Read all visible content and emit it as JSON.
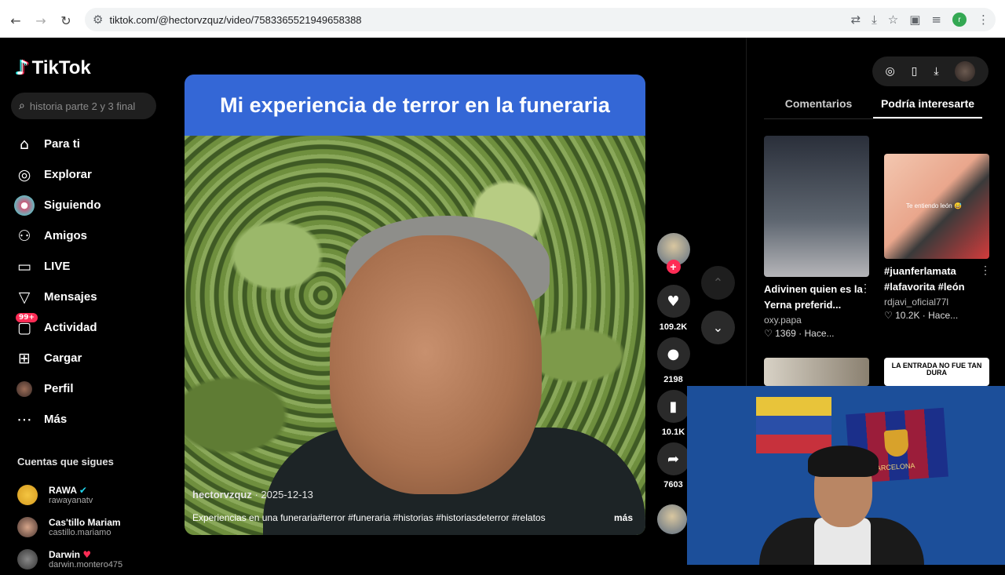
{
  "browser": {
    "url": "tiktok.com/@hectorvzquz/video/7583365521949658388",
    "profile_initial": "r"
  },
  "sidebar": {
    "logo": "TikTok",
    "search_placeholder": "historia parte 2 y 3 final",
    "nav": [
      {
        "label": "Para ti",
        "icon": "home-icon"
      },
      {
        "label": "Explorar",
        "icon": "compass-icon"
      },
      {
        "label": "Siguiendo",
        "icon": "following-icon"
      },
      {
        "label": "Amigos",
        "icon": "friends-icon"
      },
      {
        "label": "LIVE",
        "icon": "live-icon"
      },
      {
        "label": "Mensajes",
        "icon": "messages-icon"
      },
      {
        "label": "Actividad",
        "icon": "activity-icon",
        "badge": "99+"
      },
      {
        "label": "Cargar",
        "icon": "upload-icon"
      },
      {
        "label": "Perfil",
        "icon": "profile-avatar"
      },
      {
        "label": "Más",
        "icon": "more-icon"
      }
    ],
    "following_title": "Cuentas que sigues",
    "following": [
      {
        "name": "RAWA",
        "handle": "rawayanatv",
        "verified": true
      },
      {
        "name": "Cas'tillo Mariam",
        "handle": "castillo.mariamo"
      },
      {
        "name": "Darwin",
        "handle": "darwin.montero475"
      }
    ]
  },
  "video": {
    "title": "Mi experiencia de terror en la funeraria",
    "author": "hectorvzquz",
    "date": "2025-12-13",
    "description": "Experiencias en una funeraria#terror #funeraria #historias #historiasdeterror #relatos",
    "more": "más"
  },
  "actions": {
    "likes": "109.2K",
    "comments": "2198",
    "saves": "10.1K",
    "shares": "7603"
  },
  "right_panel": {
    "tabs": [
      "Comentarios",
      "Podría interesarte"
    ],
    "active_tab": 1,
    "cards": [
      {
        "title": "Adivinen quien es la Yerna preferid...",
        "user": "oxy.papa",
        "likes": "1369",
        "time": "Hace..."
      },
      {
        "title": "#juanferlamata #lafavorita #león",
        "user": "rdjavi_oficial77l",
        "likes": "10.2K",
        "time": "Hace...",
        "overlay": "Te entiendo león 😅"
      },
      {
        "title": "",
        "user": "",
        "likes": "",
        "time": ""
      },
      {
        "title": "LA ENTRADA NO FUE TAN DURA",
        "user": "",
        "likes": "",
        "time": ""
      }
    ]
  },
  "webcam": {
    "flag_text": "BARCELONA"
  }
}
